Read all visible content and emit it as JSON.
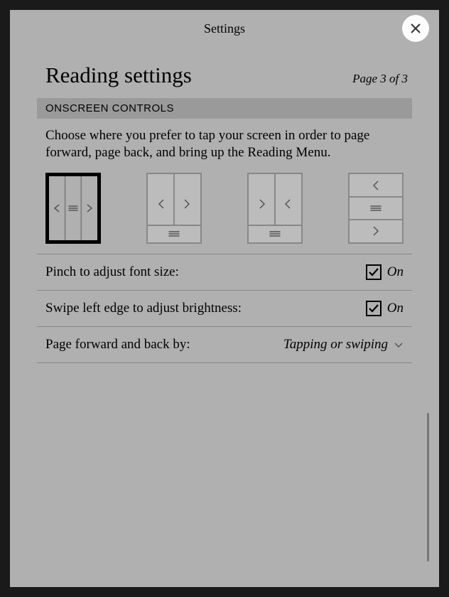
{
  "header": {
    "title": "Settings"
  },
  "page": {
    "heading": "Reading settings",
    "indicator": "Page 3 of 3"
  },
  "section": {
    "title": "ONSCREEN CONTROLS",
    "instruction": "Choose where you prefer to tap your screen in order to page forward, page back, and bring up the Reading Menu."
  },
  "settings": {
    "pinch": {
      "label": "Pinch to adjust font size:",
      "status": "On"
    },
    "swipe": {
      "label": "Swipe left edge to adjust brightness:",
      "status": "On"
    },
    "pageforward": {
      "label": "Page forward and back by:",
      "value": "Tapping or swiping"
    }
  }
}
